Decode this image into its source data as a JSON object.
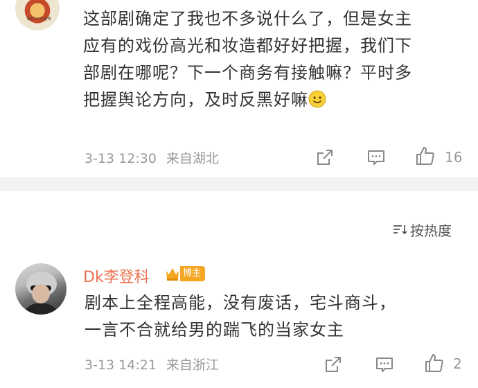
{
  "comments": [
    {
      "avatar_caption": "新的1800微博",
      "text": "这部剧确定了我也不多说什么了，但是女主\n应有的戏份高光和妆造都好好把握，我们下\n部剧在哪呢？下一个商务有接触嘛？平时多\n把握舆论方向，及时反黑好嘛",
      "emoji": "smile-face-icon",
      "time": "3-13 12:30",
      "location": "来自湖北",
      "likes": "16"
    },
    {
      "username": "Dk李登科",
      "badge": "博主",
      "text": "剧本上全程高能，没有废话，宅斗商斗，\n一言不合就给男的踹飞的当家女主",
      "time": "3-13 14:21",
      "location": "来自浙江",
      "likes": "2"
    }
  ],
  "sort": {
    "label": "按热度"
  },
  "colors": {
    "username": "#eb7350",
    "meta": "#999999",
    "badge": "#f5a623",
    "divider": "#f2f2f2"
  }
}
